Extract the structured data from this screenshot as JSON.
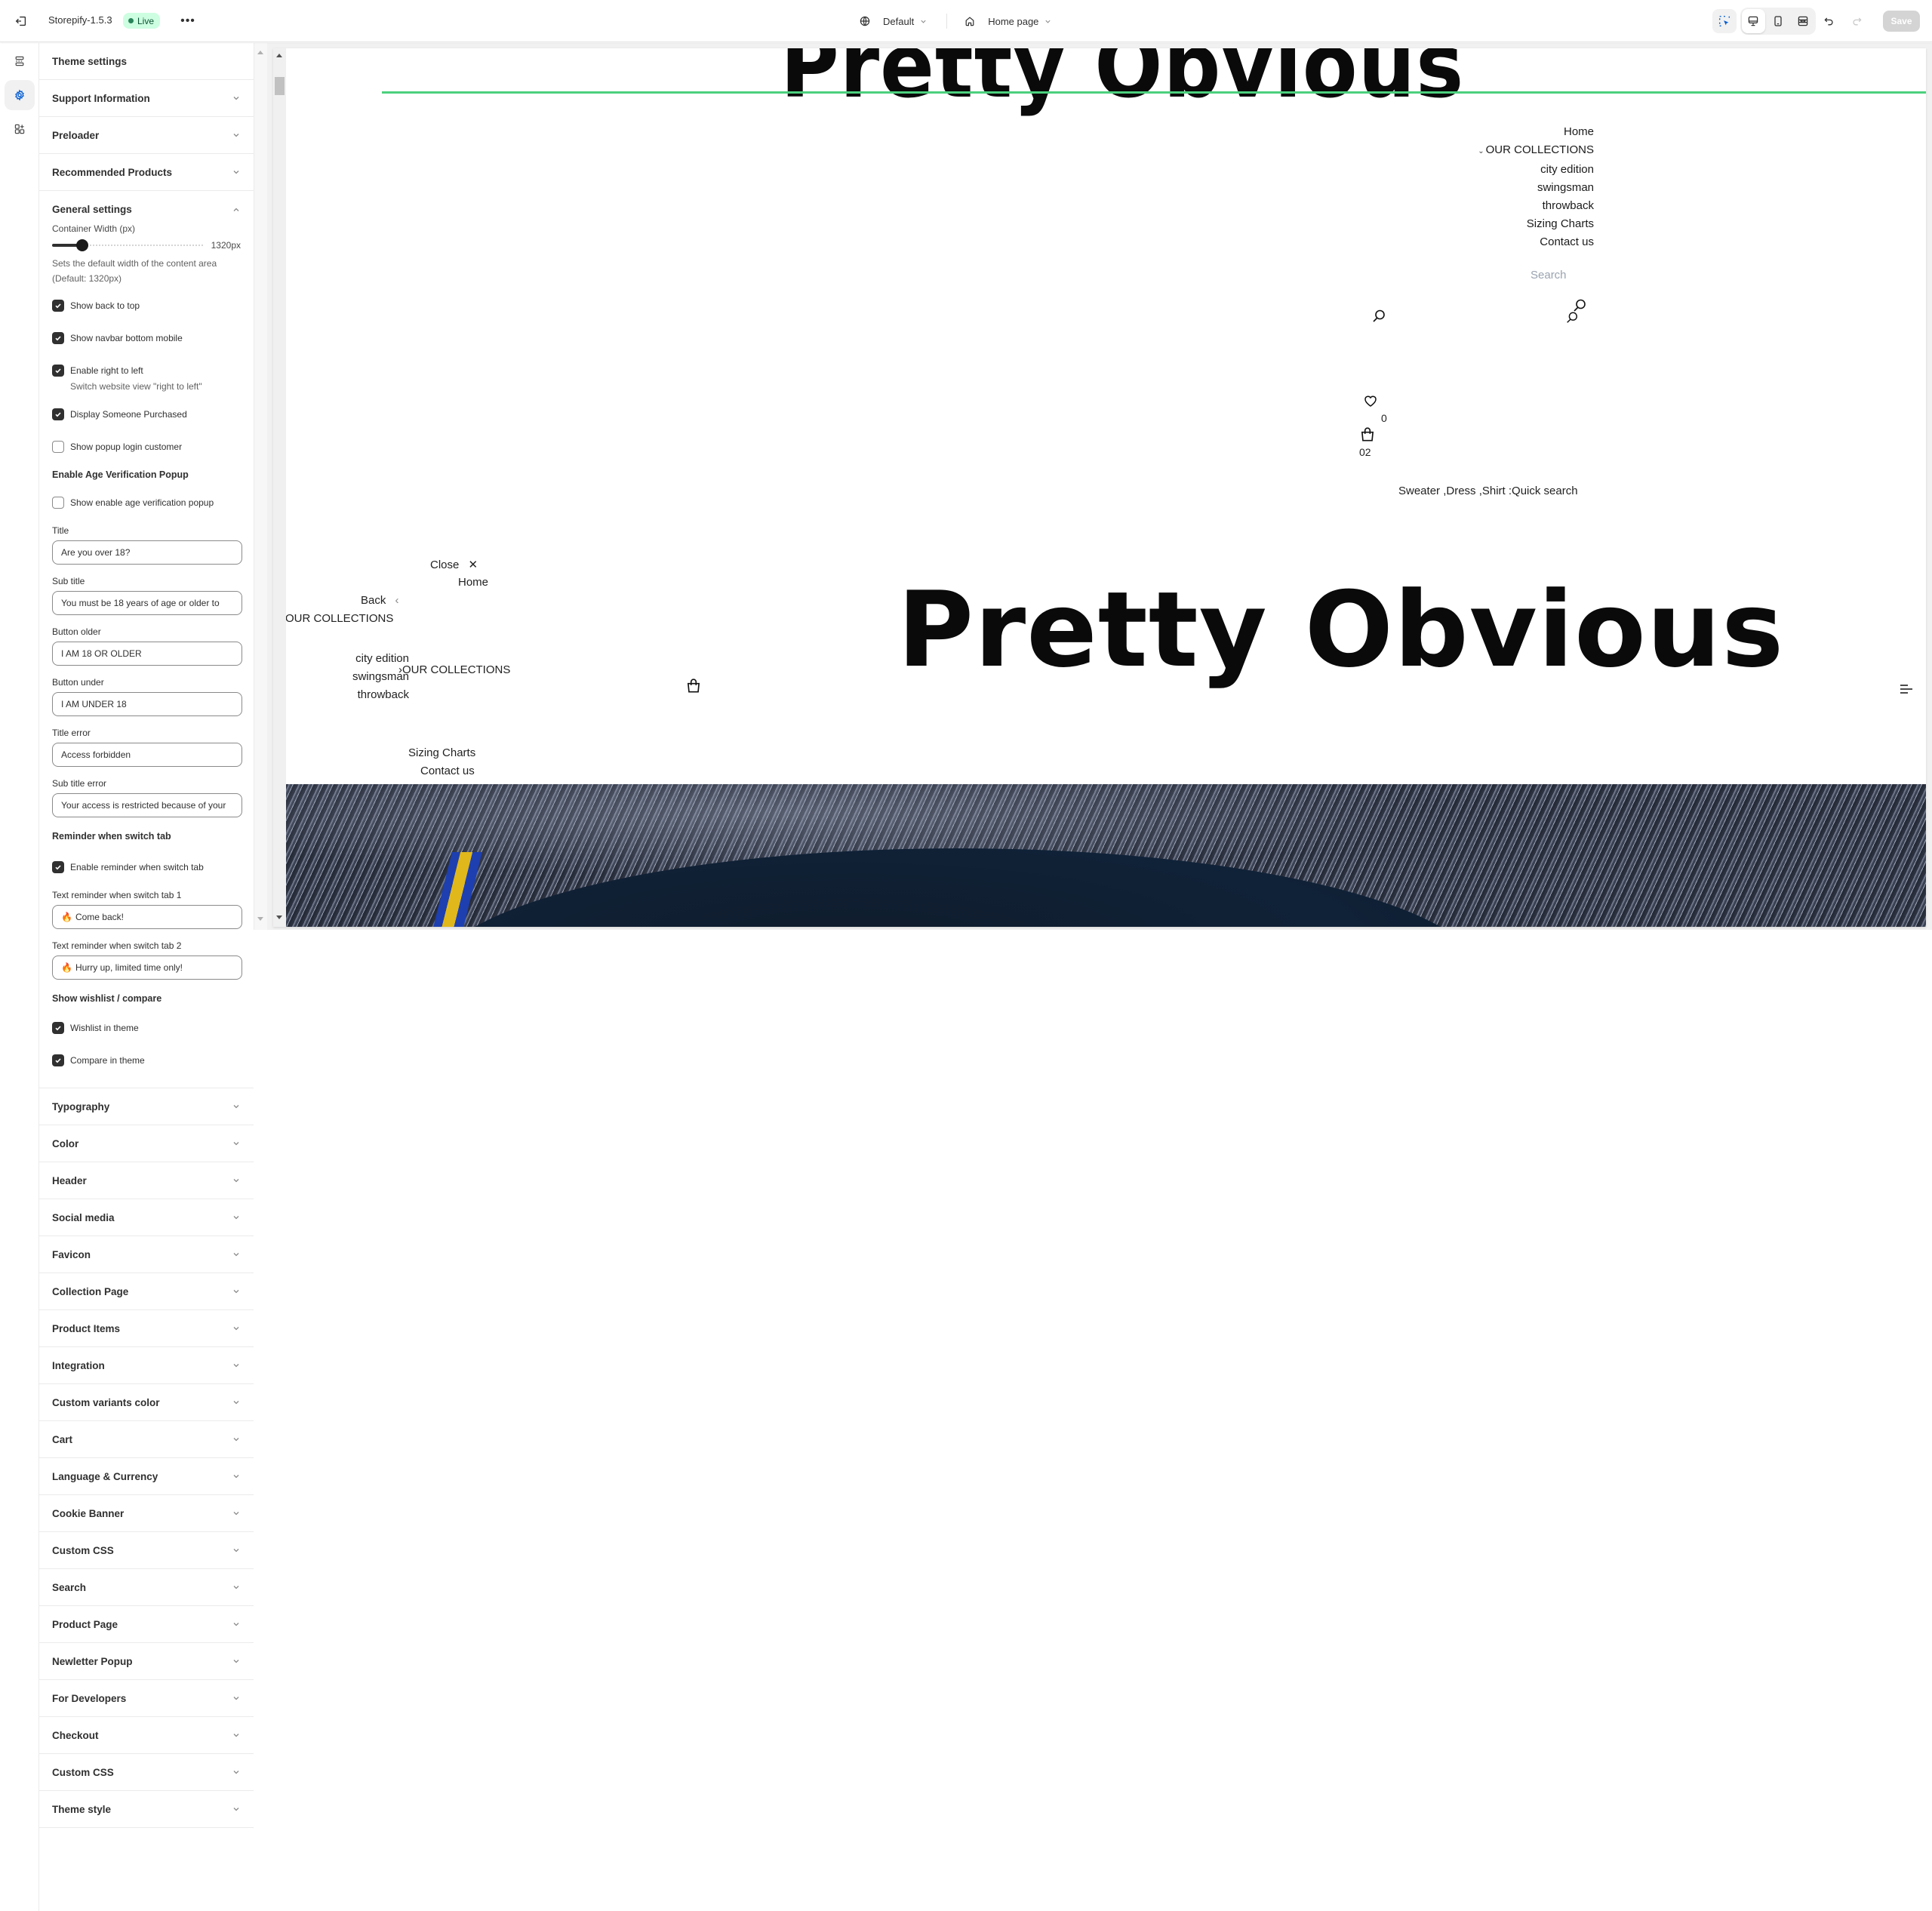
{
  "topbar": {
    "exit_icon": "exit-icon",
    "theme_name": "Storepify-1.5.3",
    "status_badge": "Live",
    "more_label": "•••",
    "locale_selector": "Default",
    "page_selector": "Home page",
    "device_modes": [
      "desktop",
      "mobile",
      "full-width"
    ],
    "active_device": "desktop",
    "save_label": "Save",
    "accent_color": "#005bd3",
    "live_color": "#29845a"
  },
  "rail": {
    "items": [
      {
        "icon": "sections-icon",
        "active": false
      },
      {
        "icon": "theme-settings-gear-icon",
        "active": true
      },
      {
        "icon": "apps-add-icon",
        "active": false
      }
    ]
  },
  "panel": {
    "title": "Theme settings",
    "sections_before": [
      "Support Information",
      "Preloader",
      "Recommended Products"
    ],
    "general": {
      "title": "General settings",
      "expanded": true,
      "container_width_label": "Container Width (px)",
      "container_width_value": "1320px",
      "container_width_fraction": 0.2,
      "container_width_help": "Sets the default width of the content area (Default: 1320px)",
      "checkboxes_1": [
        {
          "label": "Show back to top",
          "checked": true,
          "help": ""
        },
        {
          "label": "Show navbar bottom mobile",
          "checked": true,
          "help": ""
        },
        {
          "label": "Enable right to left",
          "checked": true,
          "help": "Switch website view \"right to left\""
        },
        {
          "label": "Display Someone Purchased",
          "checked": true,
          "help": ""
        },
        {
          "label": "Show popup login customer",
          "checked": false,
          "help": ""
        }
      ],
      "age_heading": "Enable Age Verification Popup",
      "age_checkbox": {
        "label": "Show enable age verification popup",
        "checked": false
      },
      "age_fields": [
        {
          "label": "Title",
          "value": "Are you over 18?"
        },
        {
          "label": "Sub title",
          "value": "You must be 18 years of age or older to"
        },
        {
          "label": "Button older",
          "value": "I AM 18 OR OLDER"
        },
        {
          "label": "Button under",
          "value": "I AM UNDER 18"
        },
        {
          "label": "Title error",
          "value": "Access forbidden"
        },
        {
          "label": "Sub title error",
          "value": "Your access is restricted because of your"
        }
      ],
      "reminder_heading": "Reminder when switch tab",
      "reminder_checkbox": {
        "label": "Enable reminder when switch tab",
        "checked": true
      },
      "reminder_fields": [
        {
          "label": "Text reminder when switch tab 1",
          "value": "Come back!",
          "emoji": "🔥"
        },
        {
          "label": "Text reminder when switch tab 2",
          "value": "Hurry up, limited time only!",
          "emoji": "🔥"
        }
      ],
      "wishlist_heading": "Show wishlist / compare",
      "wishlist_checkboxes": [
        {
          "label": "Wishlist in theme",
          "checked": true
        },
        {
          "label": "Compare in theme",
          "checked": true
        }
      ]
    },
    "sections_after": [
      "Typography",
      "Color",
      "Header",
      "Social media",
      "Favicon",
      "Collection Page",
      "Product Items",
      "Integration",
      "Custom variants color",
      "Cart",
      "Language & Currency",
      "Cookie Banner",
      "Custom CSS",
      "Search",
      "Product Page",
      "Newletter Popup",
      "For Developers",
      "Checkout",
      "Custom CSS",
      "Theme style"
    ]
  },
  "preview": {
    "logo_text": "Pretty Obvious",
    "accent_line_color": "#4cd07d",
    "nav": {
      "home": "Home",
      "collections": "OUR COLLECTIONS",
      "collection_items": [
        "city edition",
        "swingsman",
        "throwback"
      ],
      "sizing": "Sizing Charts",
      "contact": "Contact us"
    },
    "search_placeholder": "Search",
    "wishlist_count": "0",
    "cart_count": "02",
    "quick_search": "Sweater ,Dress ,Shirt :Quick search",
    "drawer": {
      "close": "Close",
      "home": "Home",
      "back": "Back",
      "collections": "OUR COLLECTIONS",
      "collection_items": [
        "city edition",
        "swingsman",
        "throwback"
      ],
      "collections_link": "OUR COLLECTIONS",
      "sizing": "Sizing Charts",
      "contact": "Contact us"
    },
    "hero_image": "hero-jersey-on-shag-rug"
  }
}
